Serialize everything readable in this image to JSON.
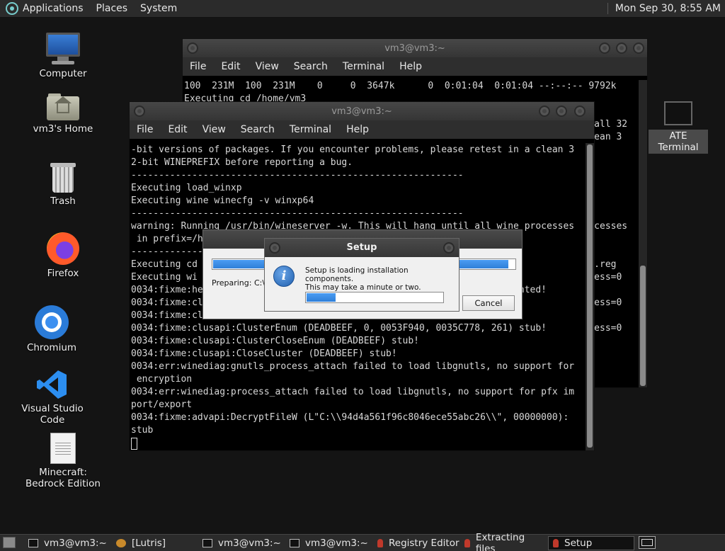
{
  "top_panel": {
    "menus": [
      "Applications",
      "Places",
      "System"
    ],
    "clock": "Mon Sep 30,  8:55 AM"
  },
  "desktop_icons": [
    {
      "label": "Computer",
      "icon": "computer-icon"
    },
    {
      "label": "vm3's Home",
      "icon": "home-folder-icon"
    },
    {
      "label": "Trash",
      "icon": "trash-icon"
    },
    {
      "label": "Firefox",
      "icon": "firefox-icon"
    },
    {
      "label": "Chromium",
      "icon": "chromium-icon"
    },
    {
      "label": "Visual Studio Code",
      "icon": "vscode-icon"
    },
    {
      "label": "Minecraft: Bedrock Edition",
      "icon": "document-icon"
    }
  ],
  "mate_terminal_icon": {
    "label": "ATE Terminal"
  },
  "back_terminal": {
    "title": "vm3@vm3:~",
    "menu": [
      "File",
      "Edit",
      "View",
      "Search",
      "Terminal",
      "Help"
    ],
    "lines": [
      "100  231M  100  231M    0     0  3647k      0  0:01:04  0:01:04 --:--:-- 9792k",
      "Executing cd /home/vm3",
      "",
      "                                                                        stall 32",
      "                                                                        clean 3",
      "",
      "",
      "",
      "",
      "",
      "",
      "                                                                        rocesses",
      "",
      "",
      "                                                                        ll.reg",
      "                                                                        ccess=0",
      "",
      "                                                                        ccess=0",
      "",
      "                                                                        ccess=0"
    ]
  },
  "front_terminal": {
    "title": "vm3@vm3:~",
    "menu": [
      "File",
      "Edit",
      "View",
      "Search",
      "Terminal",
      "Help"
    ],
    "lines": [
      "-bit versions of packages. If you encounter problems, please retest in a clean 3",
      "2-bit WINEPREFIX before reporting a bug.",
      "------------------------------------------------------------",
      "Executing load_winxp",
      "Executing wine winecfg -v winxp64",
      "------------------------------------------------------------",
      "warning: Running /usr/bin/wineserver -w. This will hang until all wine processes",
      " in prefix=/h",
      "-------------",
      "Executing cd",
      "Executing wi",
      "0034:fixme:he                                                    plemented!",
      "0034:fixme:cl",
      "0034:fixme:cl",
      "0034:fixme:clusapi:ClusterEnum (DEADBEEF, 0, 0053F940, 0035C778, 261) stub!",
      "0034:fixme:clusapi:ClusterCloseEnum (DEADBEEF) stub!",
      "0034:fixme:clusapi:CloseCluster (DEADBEEF) stub!",
      "0034:err:winediag:gnutls_process_attach failed to load libgnutls, no support for",
      " encryption",
      "0034:err:winediag:process_attach failed to load libgnutls, no support for pfx im",
      "port/export",
      "0034:fixme:advapi:DecryptFileW (L\"C:\\\\94d4a561f96c8046ece55abc26\\\\\", 00000000):",
      "stub"
    ]
  },
  "extract_dialog": {
    "status": "Preparing: C:\\9",
    "cancel_label": "Cancel",
    "progress": 0.98
  },
  "setup_dialog": {
    "title": "Setup",
    "message_line1": "Setup is loading installation components.",
    "message_line2": "This may take a minute or two.",
    "progress": 0.22,
    "icon": "info-icon"
  },
  "taskbar": {
    "items": [
      {
        "label": "vm3@vm3:~",
        "icon": "terminal-icon",
        "active": false
      },
      {
        "label": "[Lutris]",
        "icon": "lutris-icon",
        "active": false
      },
      {
        "label": "vm3@vm3:~",
        "icon": "terminal-icon",
        "active": false
      },
      {
        "label": "vm3@vm3:~",
        "icon": "terminal-icon",
        "active": false
      },
      {
        "label": "Registry Editor",
        "icon": "wine-icon",
        "active": false
      },
      {
        "label": "Extracting files",
        "icon": "wine-icon",
        "active": false
      },
      {
        "label": "Setup",
        "icon": "wine-icon",
        "active": true
      }
    ]
  },
  "colors": {
    "panel": "#2b2b2b",
    "desktop": "#141414",
    "progress": "#2f7fd9",
    "terminal_bg": "#000000"
  }
}
